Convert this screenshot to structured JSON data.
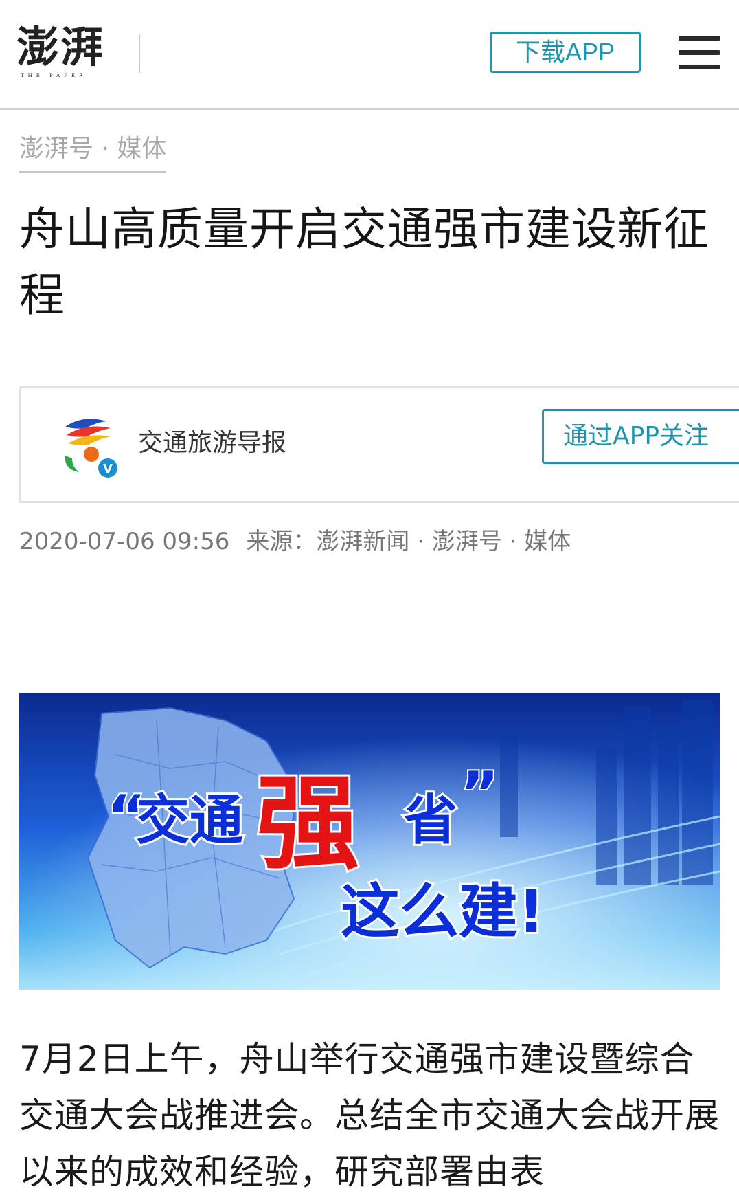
{
  "header": {
    "logo_text": "澎湃",
    "logo_subtitle": "THE PAPER",
    "download_label": "下载APP",
    "menu_icon": "hamburger-menu-icon"
  },
  "article": {
    "channel": "澎湃号 · 媒体",
    "title": "舟山高质量开启交通强市建设新征程",
    "author": {
      "name": "交通旅游导报",
      "follow_label": "通过APP关注",
      "verified_badge": "V"
    },
    "date": "2020-07-06 09:56",
    "source": "来源：澎湃新闻 · 澎湃号 · 媒体",
    "hero": {
      "quote_open": "“",
      "line1a": "交通",
      "line1b": "强",
      "line1c": "省",
      "quote_close": "”",
      "line2": "这么建!",
      "colors": {
        "background_top": "#0b2a8f",
        "background_bottom": "#5fc2f2",
        "blue_text": "#0a2fd8",
        "red_text": "#e41414"
      }
    },
    "body": "7月2日上午，舟山举行交通强市建设暨综合交通大会战推进会。总结全市交通大会战开展以来的成效和经验，研究部署由表"
  }
}
